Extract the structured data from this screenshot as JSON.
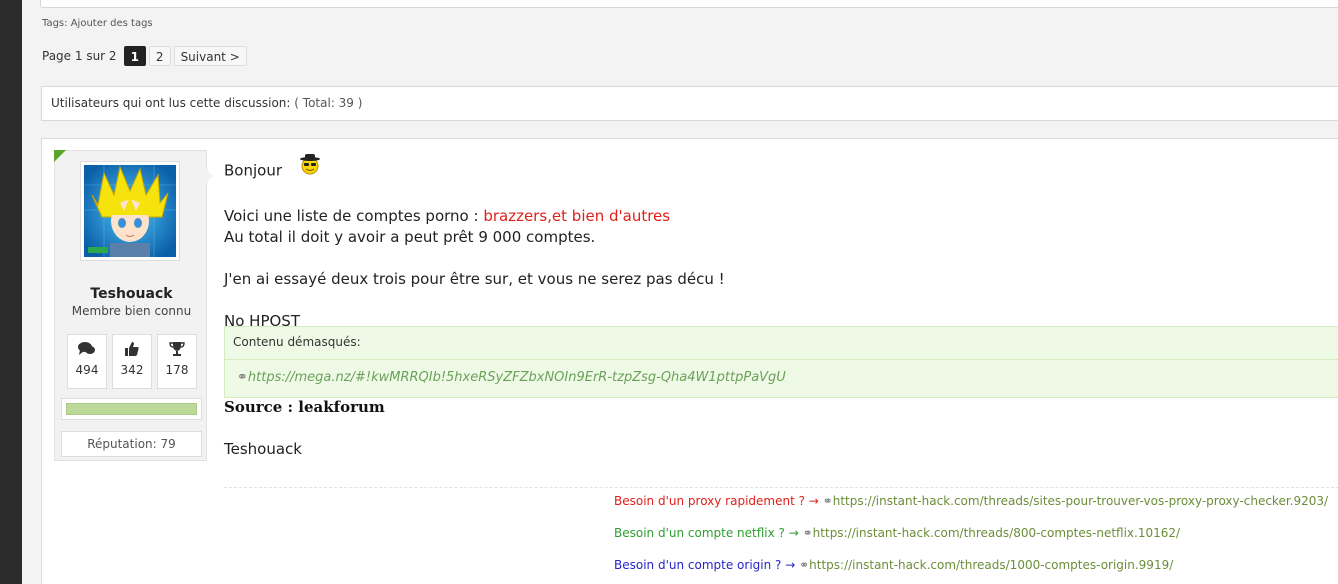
{
  "tags": {
    "label": "Tags:",
    "link": "Ajouter des tags"
  },
  "pagination": {
    "info": "Page 1 sur 2",
    "pages": [
      "1",
      "2"
    ],
    "current": "1",
    "next": "Suivant >"
  },
  "readers": {
    "label": "Utilisateurs qui ont lus cette discussion:",
    "count": "( Total: 39 )"
  },
  "user": {
    "name": "Teshouack",
    "title": "Membre bien connu",
    "stats": {
      "messages": "494",
      "likes": "342",
      "trophies": "178"
    },
    "reputation_label": "Réputation:",
    "reputation_value": "79",
    "reputation_level": 1.0
  },
  "post": {
    "greeting": "Bonjour",
    "intro_prefix": "Voici une liste de comptes porno : ",
    "intro_red": "brazzers,et bien d'autres",
    "line2": "Au total il doit y avoir a peut prêt 9 000 comptes.",
    "line3": "J'en ai essayé deux trois pour être sur, et vous ne serez pas décu !",
    "no_hpost": "No HPOST",
    "hidden_header": "Contenu démasqués:",
    "hidden_link": "https://mega.nz/#!kwMRRQIb!5hxeRSyZFZbxNOIn9ErR-tzpZsg-Qha4W1pttpPaVgU",
    "source": "Source : leakforum",
    "signature_name": "Teshouack"
  },
  "signature": [
    {
      "text": "Besoin d'un proxy rapidement ? → ",
      "color": "#e0201b",
      "url": "https://instant-hack.com/threads/sites-pour-trouver-vos-proxy-proxy-checker.9203/"
    },
    {
      "text": "Besoin d'un compte netflix ? → ",
      "color": "#2e9e2e",
      "url": "https://instant-hack.com/threads/800-comptes-netflix.10162/"
    },
    {
      "text": "Besoin d'un compte origin ? → ",
      "color": "#2525c8",
      "url": "https://instant-hack.com/threads/1000-comptes-origin.9919/"
    }
  ]
}
